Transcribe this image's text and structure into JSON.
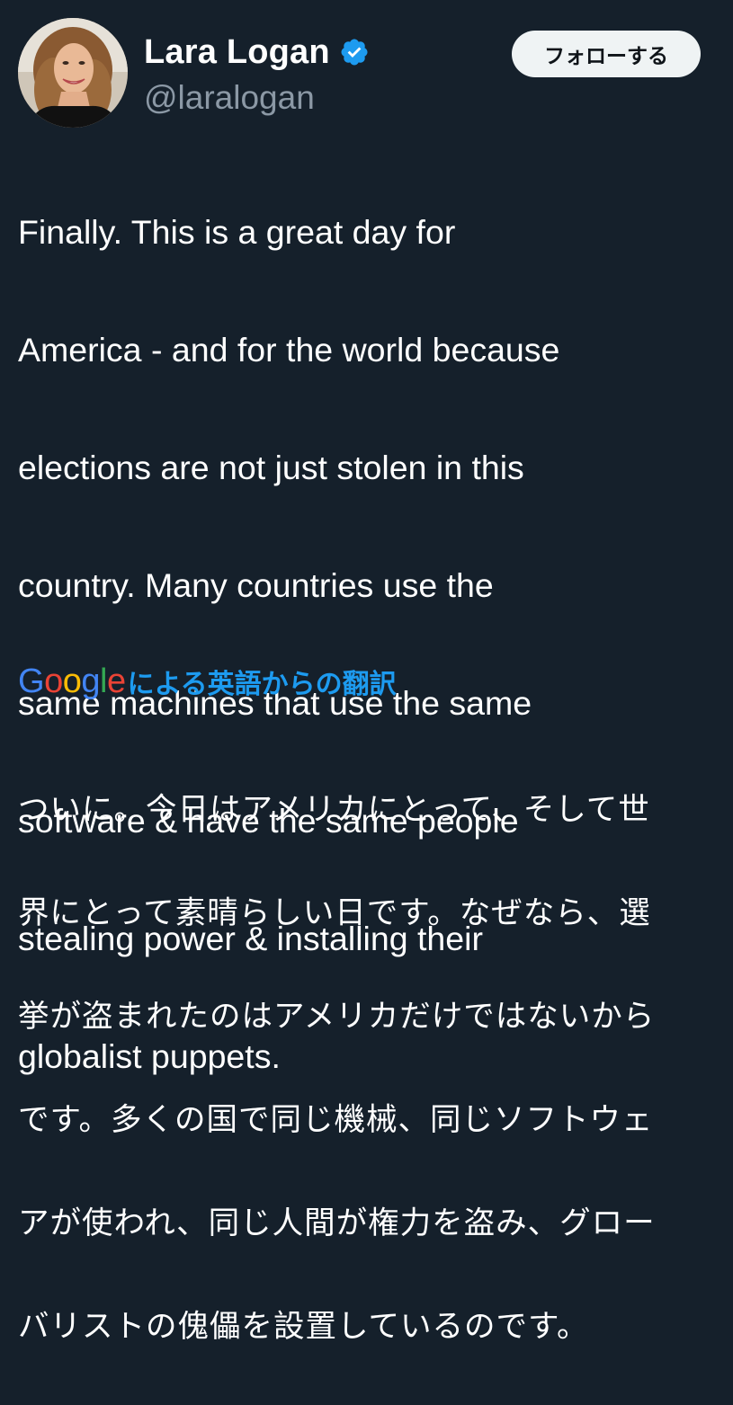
{
  "author": {
    "display_name": "Lara Logan",
    "handle": "@laralogan",
    "verified_icon": "verified-badge-icon",
    "avatar_icon": "avatar"
  },
  "follow_button": {
    "label": "フォローする"
  },
  "tweet": {
    "lines": [
      "Finally. This is a great day for",
      "America - and for the world because",
      "elections are not just stolen in this",
      "country. Many countries use the",
      "same machines that use the same",
      "software & have the same people",
      "stealing power & installing their",
      "globalist puppets."
    ]
  },
  "translation": {
    "google_letters": [
      "G",
      "o",
      "o",
      "g",
      "l",
      "e"
    ],
    "google_colors": [
      "#4285f4",
      "#ea4335",
      "#fbbc05",
      "#4285f4",
      "#34a853",
      "#ea4335"
    ],
    "label": "による英語からの翻訳",
    "lines": [
      "ついに。今日はアメリカにとって、そして世",
      "界にとって素晴らしい日です。なぜなら、選",
      "挙が盗まれたのはアメリカだけではないから",
      "です。多くの国で同じ機械、同じソフトウェ",
      "アが使われ、同じ人間が権力を盗み、グロー",
      "バリストの傀儡を設置しているのです。"
    ]
  },
  "colors": {
    "background": "#15202b",
    "accent": "#1d9bf0",
    "secondary_text": "#8b98a5"
  }
}
